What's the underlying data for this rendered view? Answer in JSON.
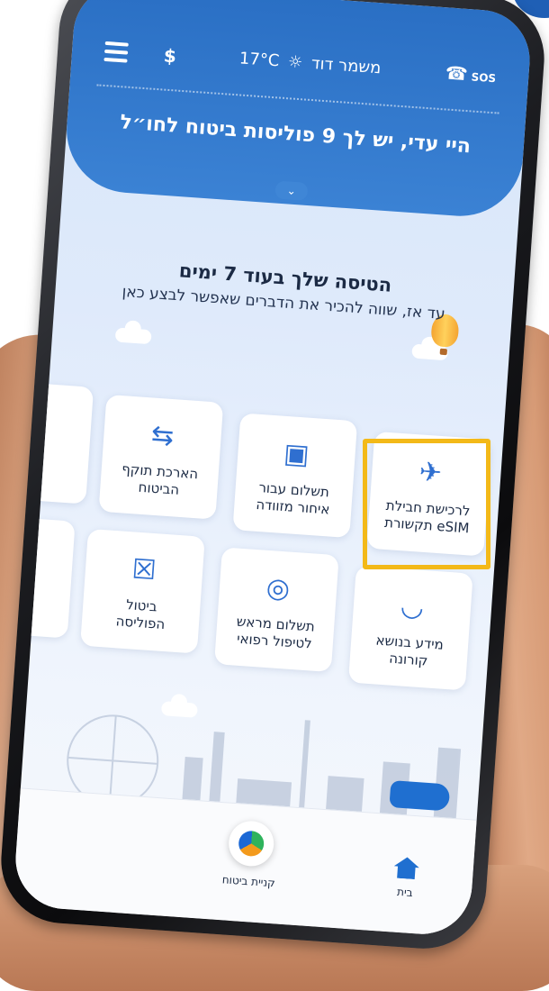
{
  "topbar": {
    "sos_label": "SOS",
    "weather_location": "משמר דוד",
    "weather_temp": "17°C"
  },
  "greeting": "היי עדי, יש לך 9 פוליסות ביטוח לחו״ל",
  "trip": {
    "title": "הטיסה שלך בעוד 7 ימים",
    "subtitle": "עד אז, שווה להכיר את הדברים שאפשר לבצע כאן"
  },
  "cards": [
    {
      "label": "לרכישת חבילת\neSIM תקשורת",
      "icon": "esim-plane-icon",
      "highlighted": true
    },
    {
      "label": "תשלום עבור\nאיחור מזוודה",
      "icon": "luggage-icon"
    },
    {
      "label": "הארכת תוקף\nהביטוח",
      "icon": "document-extend-icon"
    },
    {
      "label": "מידע בנושא\nקורונה",
      "icon": "mask-icon"
    },
    {
      "label": "תשלום מראש\nלטיפול רפואי",
      "icon": "hand-coin-icon"
    },
    {
      "label": "ביטול\nהפוליסה",
      "icon": "document-cancel-icon"
    }
  ],
  "bottombar": {
    "home_label": "בית",
    "buy_label": "קניית ביטוח"
  },
  "colors": {
    "header_blue": "#2a6fc4",
    "highlight": "#f3b918",
    "icon_blue": "#2f6fd0"
  }
}
